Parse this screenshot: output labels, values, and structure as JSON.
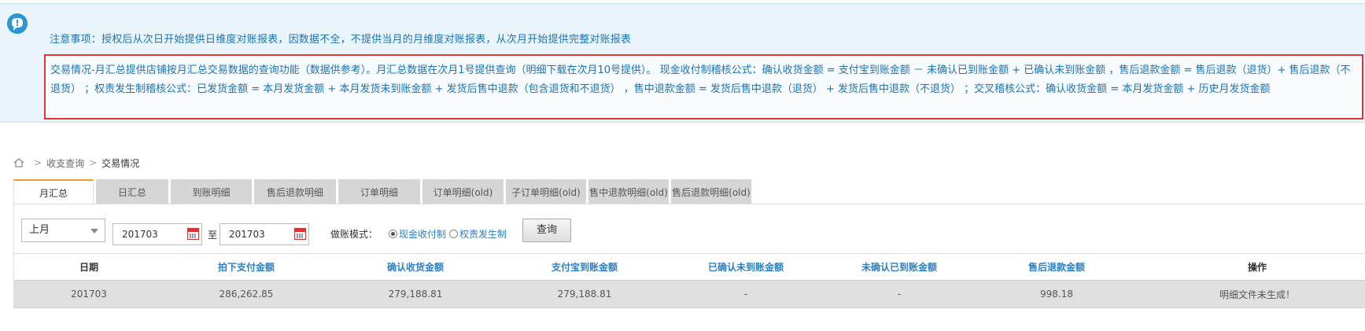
{
  "notice": {
    "title": "注意事项：授权后从次日开始提供日维度对账报表，因数据不全，不提供当月的月维度对账报表，从次月开始提供完整对账报表",
    "detail": "交易情况-月汇总提供店铺按月汇总交易数据的查询功能（数据供参考）。月汇总数据在次月1号提供查询（明细下载在次月10号提供）。 现金收付制稽核公式：确认收货金额 = 支付宝到账金额 － 未确认已到账金额 + 已确认未到账金额 ，售后退款金额 = 售后退款（退货）+ 售后退款（不退货） ；权责发生制稽核公式：已发货金额 = 本月发货金额 + 本月发货未到账金额 + 发货后售中退款（包含退货和不退货） ，售中退款金额 = 发货后售中退款（退货） + 发货后售中退款（不退货） ；交叉稽核公式：确认收货金额 = 本月发货金额 + 历史月发货金额"
  },
  "breadcrumb": {
    "items": [
      "收支查询",
      "交易情况"
    ]
  },
  "tabs": [
    {
      "label": "月汇总",
      "active": true
    },
    {
      "label": "日汇总"
    },
    {
      "label": "到账明细"
    },
    {
      "label": "售后退款明细"
    },
    {
      "label": "订单明细"
    },
    {
      "label": "订单明细(old)"
    },
    {
      "label": "子订单明细(old)"
    },
    {
      "label": "售中退款明细(old)"
    },
    {
      "label": "售后退款明细(old)"
    }
  ],
  "filter": {
    "period_select": "上月",
    "date_from": "201703",
    "to_label": "至",
    "date_to": "201703",
    "mode_label": "做账模式：",
    "modes": [
      {
        "label": "现金收付制",
        "checked": true
      },
      {
        "label": "权责发生制",
        "checked": false
      }
    ],
    "query_button": "查询"
  },
  "table": {
    "headers": [
      "日期",
      "拍下支付金额",
      "确认收货金额",
      "支付宝到账金额",
      "已确认未到账金额",
      "未确认已到账金额",
      "售后退款金额",
      "操作"
    ],
    "rows": [
      [
        "201703",
        "286,262.85",
        "279,188.81",
        "279,188.81",
        "-",
        "-",
        "998.18",
        "明细文件未生成！"
      ]
    ]
  },
  "colors": {
    "accent_blue": "#2b7fc8",
    "highlight_border": "#e0363a",
    "active_tab_top": "#f39c28"
  }
}
